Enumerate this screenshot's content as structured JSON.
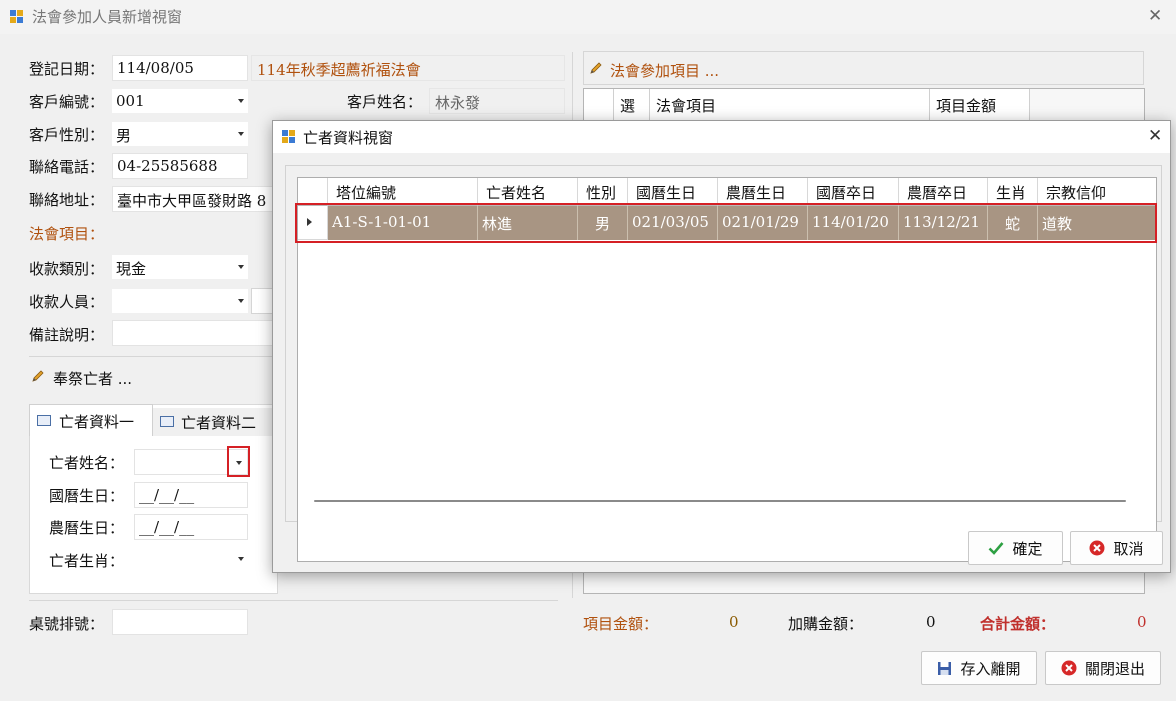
{
  "main_window": {
    "title": "法會參加人員新增視窗",
    "reg_date_label": "登記日期：",
    "reg_date_value": "114/08/05",
    "event_name": "114年秋季超薦祈福法會",
    "customer_no_label": "客戶編號：",
    "customer_no_value": "001",
    "customer_name_label": "客戶姓名：",
    "customer_name_value": "林永發",
    "gender_label": "客戶性別：",
    "gender_value": "男",
    "phone_label": "聯絡電話：",
    "phone_value": "04-25585688",
    "address_label": "聯絡地址：",
    "address_value": "臺中市大甲區發財路 8",
    "ritual_items_label": "法會項目：",
    "payment_type_label": "收款類別：",
    "payment_type_value": "現金",
    "payee_label": "收款人員：",
    "payee_value": "",
    "remarks_label": "備註說明：",
    "remarks_value": "",
    "deceased_section_title": "奉祭亡者 ...",
    "tabs": [
      "亡者資料一",
      "亡者資料二"
    ],
    "deceased_name_label": "亡者姓名：",
    "deceased_name_value": "",
    "solar_birth_label": "國曆生日：",
    "solar_birth_value": "__/__/__",
    "lunar_birth_label": "農曆生日：",
    "lunar_birth_value": "__/__/__",
    "zodiac_label": "亡者生肖：",
    "zodiac_value": "",
    "table_no_label": "桌號排號：",
    "table_no_value": "",
    "ritual_panel_title": "法會參加項目 ...",
    "ritual_grid_headers": [
      "選",
      "法會項目",
      "項目金額"
    ],
    "item_amount_label": "項目金額：",
    "item_amount_value": "0",
    "addon_amount_label": "加購金額：",
    "addon_amount_value": "0",
    "total_amount_label": "合計金額：",
    "total_amount_value": "0",
    "save_button": "存入離開",
    "close_button": "關閉退出"
  },
  "dialog": {
    "title": "亡者資料視窗",
    "columns": [
      "塔位編號",
      "亡者姓名",
      "性別",
      "國曆生日",
      "農曆生日",
      "國曆卒日",
      "農曆卒日",
      "生肖",
      "宗教信仰"
    ],
    "rows": [
      [
        "A1-S-1-01-01",
        "林進",
        "男",
        "021/03/05",
        "021/01/29",
        "114/01/20",
        "113/12/21",
        "蛇",
        "道教"
      ]
    ],
    "confirm_button": "確定",
    "cancel_button": "取消"
  },
  "colors": {
    "selected_row": "#a89583",
    "highlight_box": "#d52025",
    "label_orange": "#b0510e",
    "total_red": "#c0302c",
    "amount_brown": "#8a5a00"
  }
}
